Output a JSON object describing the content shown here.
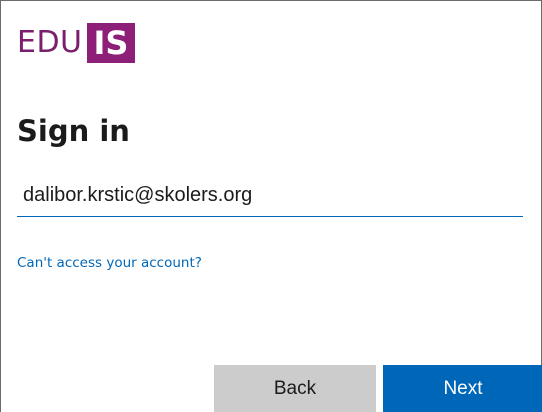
{
  "logo": {
    "part1": "EDU",
    "part2": "IS",
    "part1_color": "#7a1f6e",
    "part2_bg": "#8e1f78"
  },
  "signin": {
    "title": "Sign in",
    "email_value": "dalibor.krstic@skolers.org",
    "help_link": "Can't access your account?",
    "back_label": "Back",
    "next_label": "Next"
  },
  "colors": {
    "accent": "#0067b8",
    "back_button": "#cccccc"
  }
}
